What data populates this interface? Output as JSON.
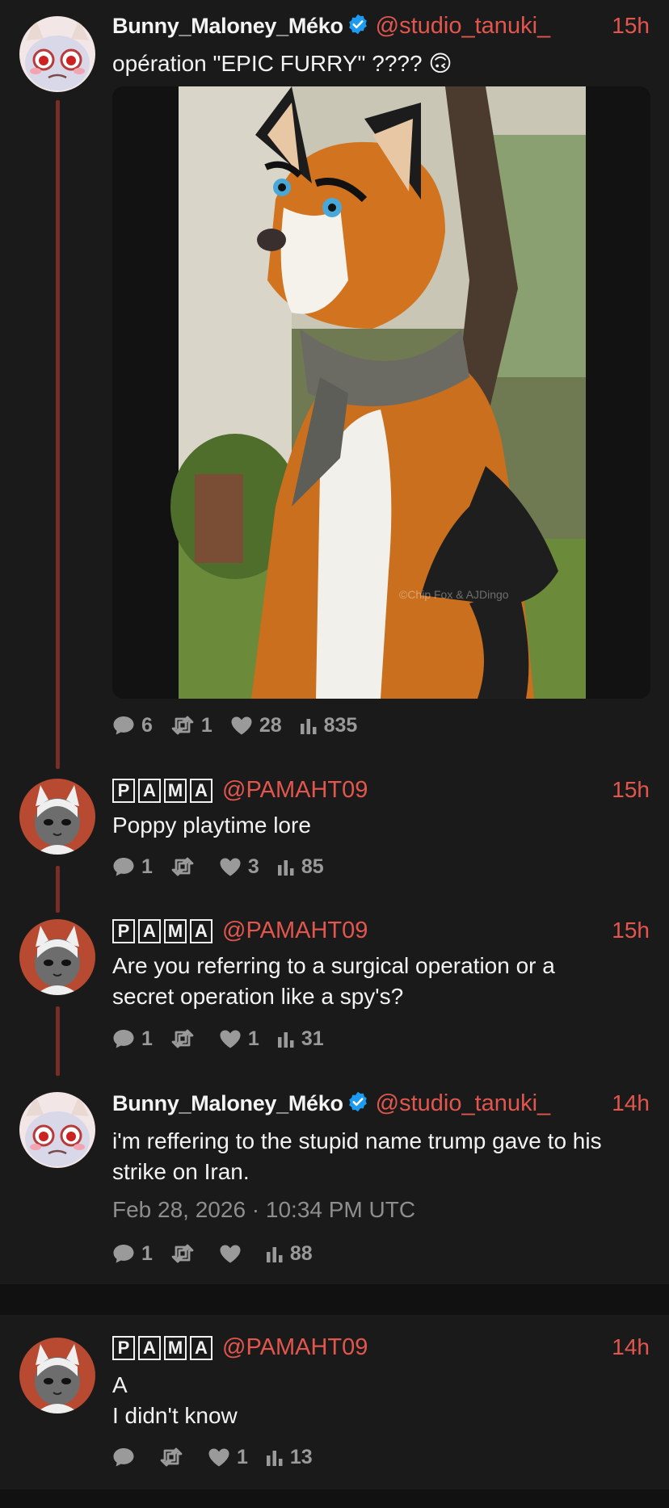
{
  "tweets": [
    {
      "display_name": "Bunny_Maloney_Méko",
      "handle": "@studio_tanuki_",
      "time": "15h",
      "text": "opération \"EPIC FURRY\" ???? 🙃",
      "image_credit": "©Chip Fox & AJDingo",
      "replies": "6",
      "reposts": "1",
      "likes": "28",
      "views": "835"
    },
    {
      "display_name_letters": [
        "P",
        "A",
        "M",
        "A"
      ],
      "handle": "@PAMAHT09",
      "time": "15h",
      "text": "Poppy playtime lore",
      "replies": "1",
      "reposts": "",
      "likes": "3",
      "views": "85"
    },
    {
      "display_name_letters": [
        "P",
        "A",
        "M",
        "A"
      ],
      "handle": "@PAMAHT09",
      "time": "15h",
      "text": "Are you referring to a surgical operation or a secret operation like a spy's?",
      "replies": "1",
      "reposts": "",
      "likes": "1",
      "views": "31"
    },
    {
      "display_name": "Bunny_Maloney_Méko",
      "handle": "@studio_tanuki_",
      "time": "14h",
      "text": "i'm reffering to the stupid name trump gave to his strike on Iran.",
      "date": "Feb 28, 2026 · 10:34 PM UTC",
      "replies": "1",
      "reposts": "",
      "likes": "",
      "views": "88"
    },
    {
      "display_name_letters": [
        "P",
        "A",
        "M",
        "A"
      ],
      "handle": "@PAMAHT09",
      "time": "14h",
      "text_line1": "A",
      "text_line2": "I didn't know",
      "replies": "",
      "reposts": "",
      "likes": "1",
      "views": "13"
    }
  ],
  "colors": {
    "background": "#1a1a1a",
    "accent": "#e2564d",
    "thread_line": "#7a2d26",
    "muted": "#9a9a9a",
    "verified": "#1d9bf0"
  },
  "icons": [
    "reply-icon",
    "repost-icon",
    "like-icon",
    "views-icon",
    "verified-icon"
  ]
}
